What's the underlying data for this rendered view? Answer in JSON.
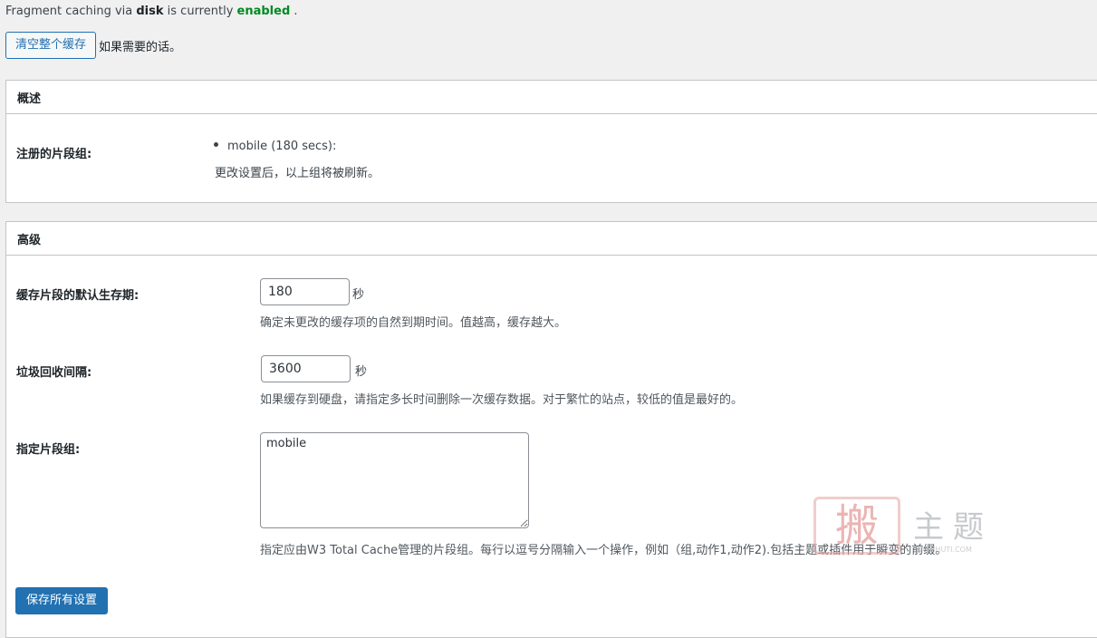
{
  "status": {
    "prefix": "Fragment caching via ",
    "engine": "disk",
    "middle": " is currently ",
    "state": "enabled",
    "suffix": " ."
  },
  "flush": {
    "button_label": "清空整个缓存",
    "note": "如果需要的话。"
  },
  "overview": {
    "title": "概述",
    "registered_label": "注册的片段组:",
    "groups": [
      "mobile (180 secs):"
    ],
    "refresh_note": "更改设置后，以上组将被刷新。"
  },
  "advanced": {
    "title": "高级",
    "lifetime": {
      "label": "缓存片段的默认生存期:",
      "value": "180",
      "unit": "秒",
      "description": "确定未更改的缓存项的自然到期时间。值越高，缓存越大。"
    },
    "gc_interval": {
      "label": "垃圾回收间隔:",
      "value": "3600",
      "unit": "秒",
      "description": "如果缓存到硬盘，请指定多长时间删除一次缓存数据。对于繁忙的站点，较低的值是最好的。"
    },
    "groups": {
      "label": "指定片段组:",
      "value": "mobile",
      "description": "指定应由W3 Total Cache管理的片段组。每行以逗号分隔输入一个操作，例如（组,动作1,动作2).包括主题或插件用于瞬变的前缀。"
    },
    "save_label": "保存所有设置"
  },
  "watermark": {
    "seal": "搬",
    "chars": "主题",
    "url": "BANZHUTI.COM"
  },
  "colors": {
    "accent": "#2271b1",
    "enabled": "#008a20",
    "border": "#c3c4c7",
    "background": "#f0f0f1"
  }
}
